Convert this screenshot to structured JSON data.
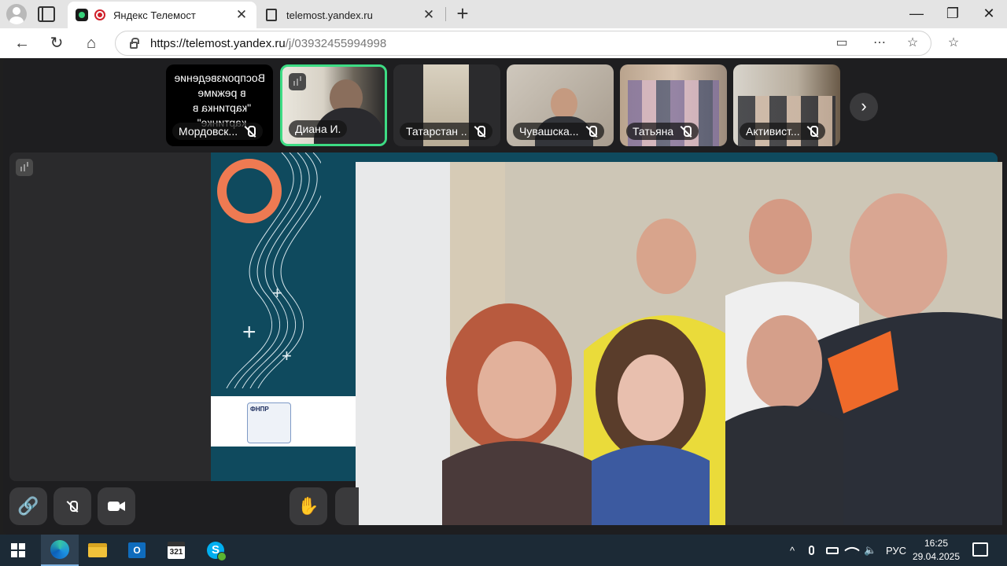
{
  "browser": {
    "tabs": [
      {
        "label": "Яндекс Телемост",
        "active": true
      },
      {
        "label": "telemost.yandex.ru",
        "active": false
      }
    ],
    "close_glyph": "✕",
    "new_tab_glyph": "+",
    "window": {
      "minimize": "—",
      "restore": "❐",
      "close": "✕"
    },
    "nav": {
      "back": "←",
      "reload": "↻",
      "home": "⌂"
    },
    "url": {
      "host": "https://telemost.yandex.ru",
      "path": "/j/03932455994998"
    },
    "url_icons": {
      "camera": "▭",
      "more": "⋯",
      "favorite": "☆",
      "favorites_bar": "☆"
    }
  },
  "telemost": {
    "participants": [
      {
        "name": "Мордовск...",
        "muted": true,
        "pip_text": "Воспроизведение в режиме \"картинка в картинке\""
      },
      {
        "name": "Диана И.",
        "muted": false,
        "speaking": true
      },
      {
        "name": "Татарстан ...",
        "muted": true
      },
      {
        "name": "Чувашска...",
        "muted": true
      },
      {
        "name": "Татьяна",
        "muted": true
      },
      {
        "name": "Активист...",
        "muted": true
      }
    ],
    "next_glyph": "›",
    "slide": {
      "logo_text": "ФНПР"
    },
    "controls": {
      "link": "🔗",
      "hand": "✋"
    }
  },
  "taskbar": {
    "language": "РУС",
    "time": "16:25",
    "date": "29.04.2025",
    "outlook_letter": "O",
    "calendar_text": "321",
    "skype_letter": "S",
    "tray_up": "^",
    "volume": "🔈"
  }
}
